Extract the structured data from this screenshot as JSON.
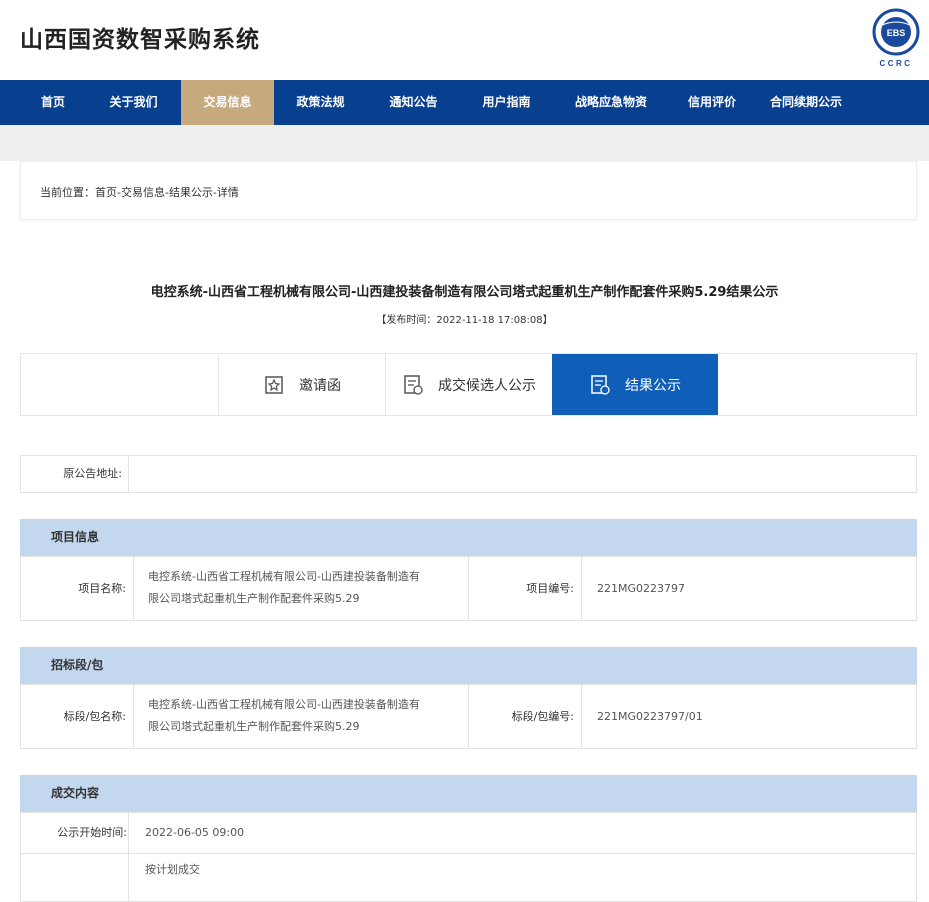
{
  "header": {
    "site_title": "山西国资数智采购系统",
    "logo_text": "CCRC",
    "logo_inner": "EBS"
  },
  "nav": {
    "items": [
      {
        "label": "首页"
      },
      {
        "label": "关于我们"
      },
      {
        "label": "交易信息",
        "active": true
      },
      {
        "label": "政策法规"
      },
      {
        "label": "通知公告"
      },
      {
        "label": "用户指南"
      },
      {
        "label": "战略应急物资"
      },
      {
        "label": "信用评价"
      },
      {
        "label": "合同续期公示"
      }
    ]
  },
  "breadcrumb": "当前位置：首页-交易信息-结果公示-详情",
  "article": {
    "title": "电控系统-山西省工程机械有限公司-山西建投装备制造有限公司塔式起重机生产制作配套件采购5.29结果公示",
    "publish_time": "【发布时间：2022-11-18 17:08:08】"
  },
  "tabs": [
    {
      "label": "邀请函",
      "icon": "invitation-icon"
    },
    {
      "label": "成交候选人公示",
      "icon": "candidate-list-icon"
    },
    {
      "label": "结果公示",
      "icon": "result-icon",
      "active": true
    }
  ],
  "original_notice": {
    "label": "原公告地址:",
    "value": ""
  },
  "project_info": {
    "heading": "项目信息",
    "name_label": "项目名称:",
    "name_value_line1": "电控系统-山西省工程机械有限公司-山西建投装备制造有",
    "name_value_line2": "限公司塔式起重机生产制作配套件采购5.29",
    "code_label": "项目编号:",
    "code_value": "221MG0223797"
  },
  "lot_info": {
    "heading": "招标段/包",
    "name_label": "标段/包名称:",
    "name_value_line1": "电控系统-山西省工程机械有限公司-山西建投装备制造有",
    "name_value_line2": "限公司塔式起重机生产制作配套件采购5.29",
    "code_label": "标段/包编号:",
    "code_value": "221MG0223797/01"
  },
  "deal_content": {
    "heading": "成交内容",
    "start_label": "公示开始时间:",
    "start_value": "2022-06-05 09:00",
    "note": "按计划成交"
  },
  "colors": {
    "nav_bg": "#083f8f",
    "nav_active": "#c7a97e",
    "tab_active": "#0f5fb8",
    "section_head": "#c3d7ee"
  }
}
